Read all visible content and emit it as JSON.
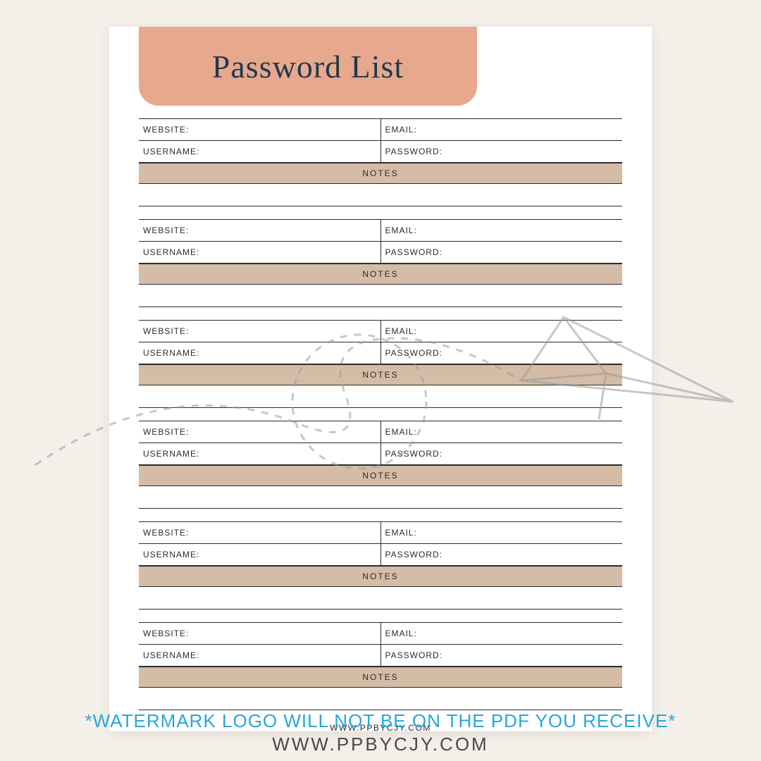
{
  "title": "Password List",
  "labels": {
    "website": "WEBSITE:",
    "email": "EMAIL:",
    "username": "USERNAME:",
    "password": "PASSWORD:",
    "notes": "NOTES"
  },
  "entries_count": 6,
  "page_footer": "WWW.PPBYCJY.COM",
  "caption_line1": "*WATERMARK LOGO WILL NOT BE ON THE PDF YOU RECEIVE*",
  "caption_line2": "WWW.PPBYCJY.COM",
  "colors": {
    "banner": "#e8a88d",
    "notes_bg": "#d4bca6",
    "title_text": "#1f3a4d",
    "caption_blue": "#2aa6d6"
  }
}
